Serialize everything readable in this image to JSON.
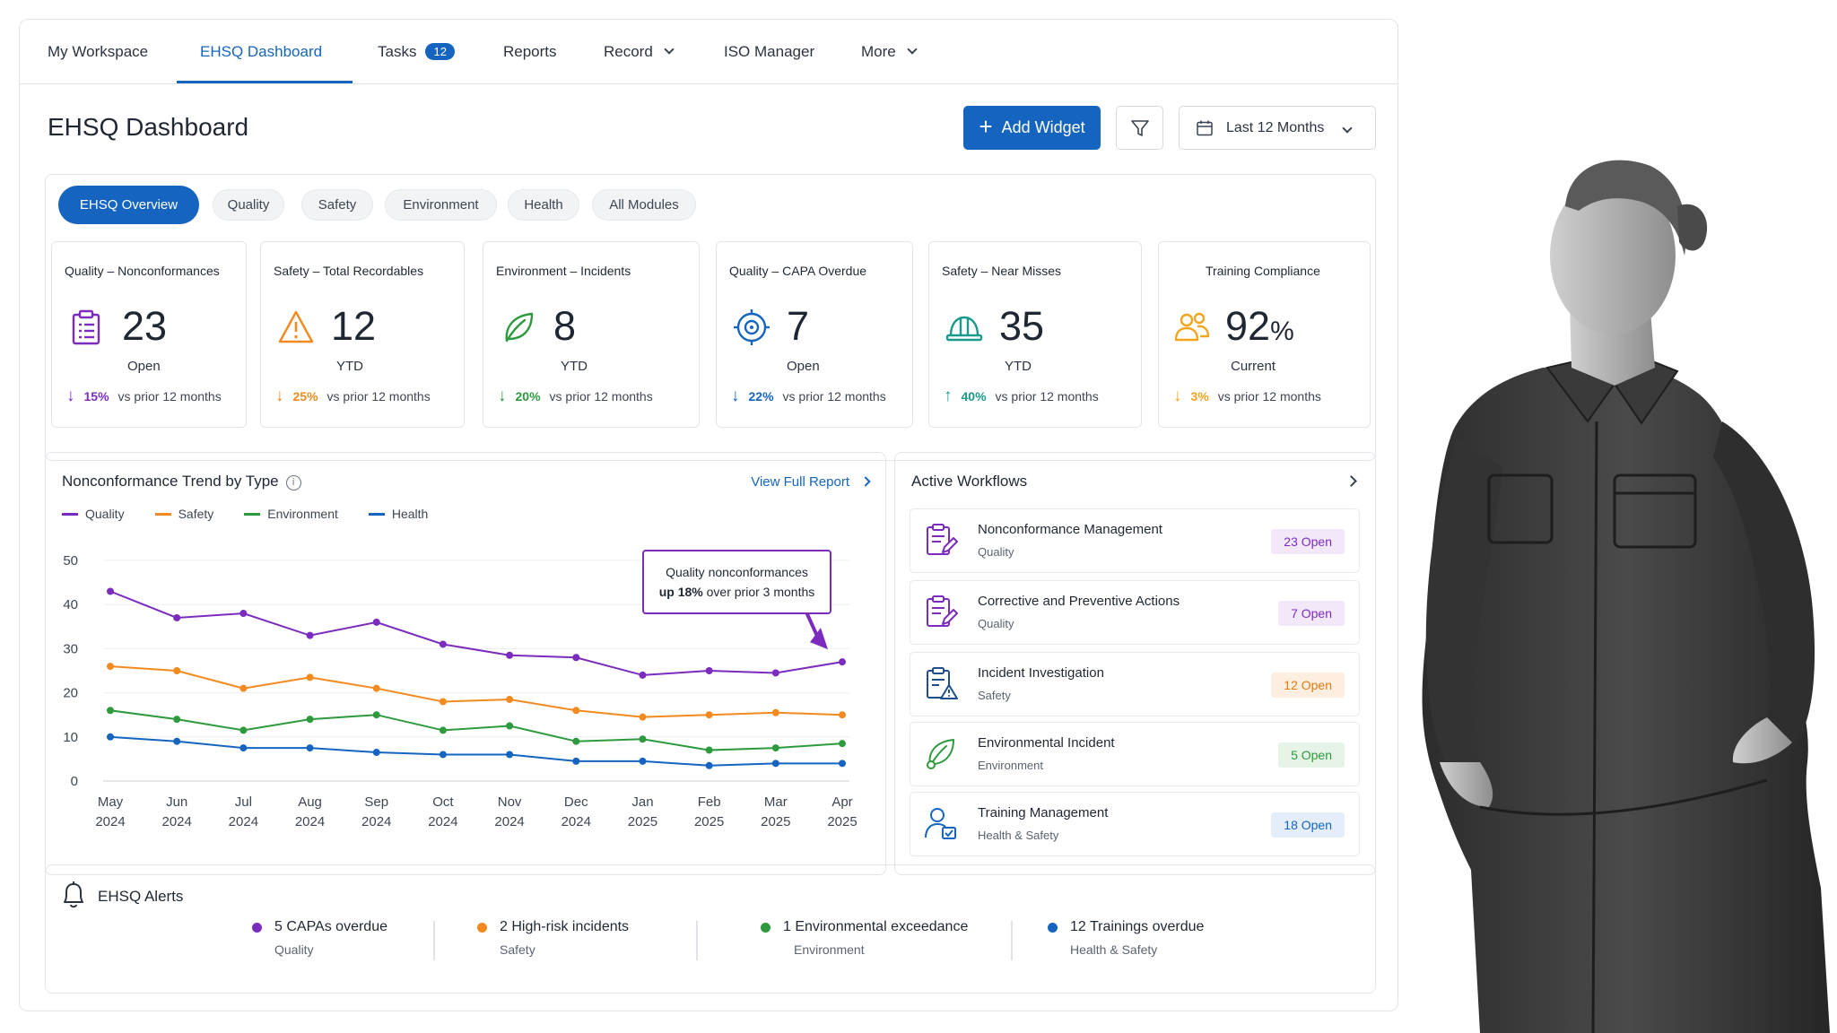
{
  "nav": {
    "items": [
      "My Workspace",
      "EHSQ Dashboard",
      "Tasks",
      "Reports",
      "Record",
      "ISO Manager",
      "More"
    ],
    "tasks_badge": "12",
    "active": "EHSQ Dashboard"
  },
  "header": {
    "title": "EHSQ Dashboard",
    "add_widget": "Add Widget",
    "date_range": "Last 12 Months"
  },
  "tabs": [
    "EHSQ Overview",
    "Quality",
    "Safety",
    "Environment",
    "Health",
    "All Modules"
  ],
  "kpis": [
    {
      "title": "Quality – Nonconformances",
      "value": "23",
      "sub": "Open",
      "trend_dir": "down",
      "trend_value": "15%",
      "trend_text": "vs prior 12 months",
      "color": "#7b2cbf",
      "icon": "clipboard-list-icon"
    },
    {
      "title": "Safety – Total Recordables",
      "value": "12",
      "sub": "YTD",
      "trend_dir": "down",
      "trend_value": "25%",
      "trend_text": "vs prior 12 months",
      "color": "#f28a1f",
      "icon": "warning-triangle-icon"
    },
    {
      "title": "Environment – Incidents",
      "value": "8",
      "sub": "YTD",
      "trend_dir": "down",
      "trend_value": "20%",
      "trend_text": "vs prior 12 months",
      "color": "#2e9a3e",
      "icon": "leaf-icon"
    },
    {
      "title": "Quality – CAPA Overdue",
      "value": "7",
      "sub": "Open",
      "trend_dir": "down",
      "trend_value": "22%",
      "trend_text": "vs prior 12 months",
      "color": "#1565c0",
      "icon": "target-icon"
    },
    {
      "title": "Safety – Near Misses",
      "value": "35",
      "sub": "YTD",
      "trend_dir": "up",
      "trend_value": "40%",
      "trend_text": "vs prior 12 months",
      "color": "#1a9a8a",
      "icon": "hard-hat-icon"
    },
    {
      "title": "Training Compliance",
      "value": "92",
      "value_suffix": "%",
      "sub": "Current",
      "trend_dir": "down",
      "trend_value": "3%",
      "trend_text": "vs prior 12 months",
      "color": "#f2a41f",
      "icon": "people-icon"
    }
  ],
  "chart_panel": {
    "title": "Nonconformance Trend by Type",
    "link": "View Full Report",
    "callout_line1": "Quality nonconformances",
    "callout_bold": "up 18%",
    "callout_rest": "over prior 3 months"
  },
  "chart_data": {
    "type": "line",
    "x": [
      "May 2024",
      "Jun 2024",
      "Jul 2024",
      "Aug 2024",
      "Sep 2024",
      "Oct 2024",
      "Nov 2024",
      "Dec 2024",
      "Jan 2025",
      "Feb 2025",
      "Mar 2025",
      "Apr 2025"
    ],
    "x_month": [
      "May",
      "Jun",
      "Jul",
      "Aug",
      "Sep",
      "Oct",
      "Nov",
      "Dec",
      "Jan",
      "Feb",
      "Mar",
      "Apr"
    ],
    "x_year": [
      "2024",
      "2024",
      "2024",
      "2024",
      "2024",
      "2024",
      "2024",
      "2024",
      "2025",
      "2025",
      "2025",
      "2025"
    ],
    "yticks": [
      0,
      10,
      20,
      30,
      40,
      50
    ],
    "ylim": [
      0,
      50
    ],
    "grid": "horizontal",
    "legend_placement": "top-left",
    "series": [
      {
        "name": "Quality",
        "color": "#7b2cbf",
        "values": [
          43,
          37,
          38,
          33,
          36,
          31,
          28.5,
          28,
          24,
          25,
          24.5,
          27
        ]
      },
      {
        "name": "Safety",
        "color": "#f28a1f",
        "values": [
          26,
          25,
          21,
          23.5,
          21,
          18,
          18.5,
          16,
          14.5,
          15,
          15.5,
          15
        ]
      },
      {
        "name": "Environment",
        "color": "#2e9a3e",
        "values": [
          16,
          14,
          11.5,
          14,
          15,
          11.5,
          12.5,
          9,
          9.5,
          7,
          7.5,
          8.5
        ]
      },
      {
        "name": "Health",
        "color": "#1565c0",
        "values": [
          10,
          9,
          7.5,
          7.5,
          6.5,
          6,
          6,
          4.5,
          4.5,
          3.5,
          4,
          4
        ]
      }
    ]
  },
  "workflows": {
    "title": "Active Workflows",
    "items": [
      {
        "name": "Nonconformance Management",
        "module": "Quality",
        "badge": "23 Open",
        "color": "#7b2cbf",
        "badge_bg": "#f2e8fa",
        "icon": "clipboard-edit-icon"
      },
      {
        "name": "Corrective and Preventive Actions",
        "module": "Quality",
        "badge": "7 Open",
        "color": "#7b2cbf",
        "badge_bg": "#f2e8fa",
        "icon": "clipboard-edit-icon"
      },
      {
        "name": "Incident Investigation",
        "module": "Safety",
        "badge": "12 Open",
        "color": "#f28a1f",
        "badge_bg": "#fdeee0",
        "icon": "clipboard-warning-icon"
      },
      {
        "name": "Environmental Incident",
        "module": "Environment",
        "badge": "5 Open",
        "color": "#2e9a3e",
        "badge_bg": "#e6f4e8",
        "icon": "leaf-icon"
      },
      {
        "name": "Training Management",
        "module": "Health & Safety",
        "badge": "18 Open",
        "color": "#1565c0",
        "badge_bg": "#e3eefa",
        "icon": "user-check-icon"
      }
    ]
  },
  "alerts": {
    "title": "EHSQ Alerts",
    "items": [
      {
        "text": "5 CAPAs overdue",
        "module": "Quality",
        "color": "#7b2cbf"
      },
      {
        "text": "2 High-risk incidents",
        "module": "Safety",
        "color": "#f28a1f"
      },
      {
        "text": "1 Environmental exceedance",
        "module": "Environment",
        "color": "#2e9a3e"
      },
      {
        "text": "12 Trainings overdue",
        "module": "Health & Safety",
        "color": "#1565c0"
      }
    ]
  }
}
